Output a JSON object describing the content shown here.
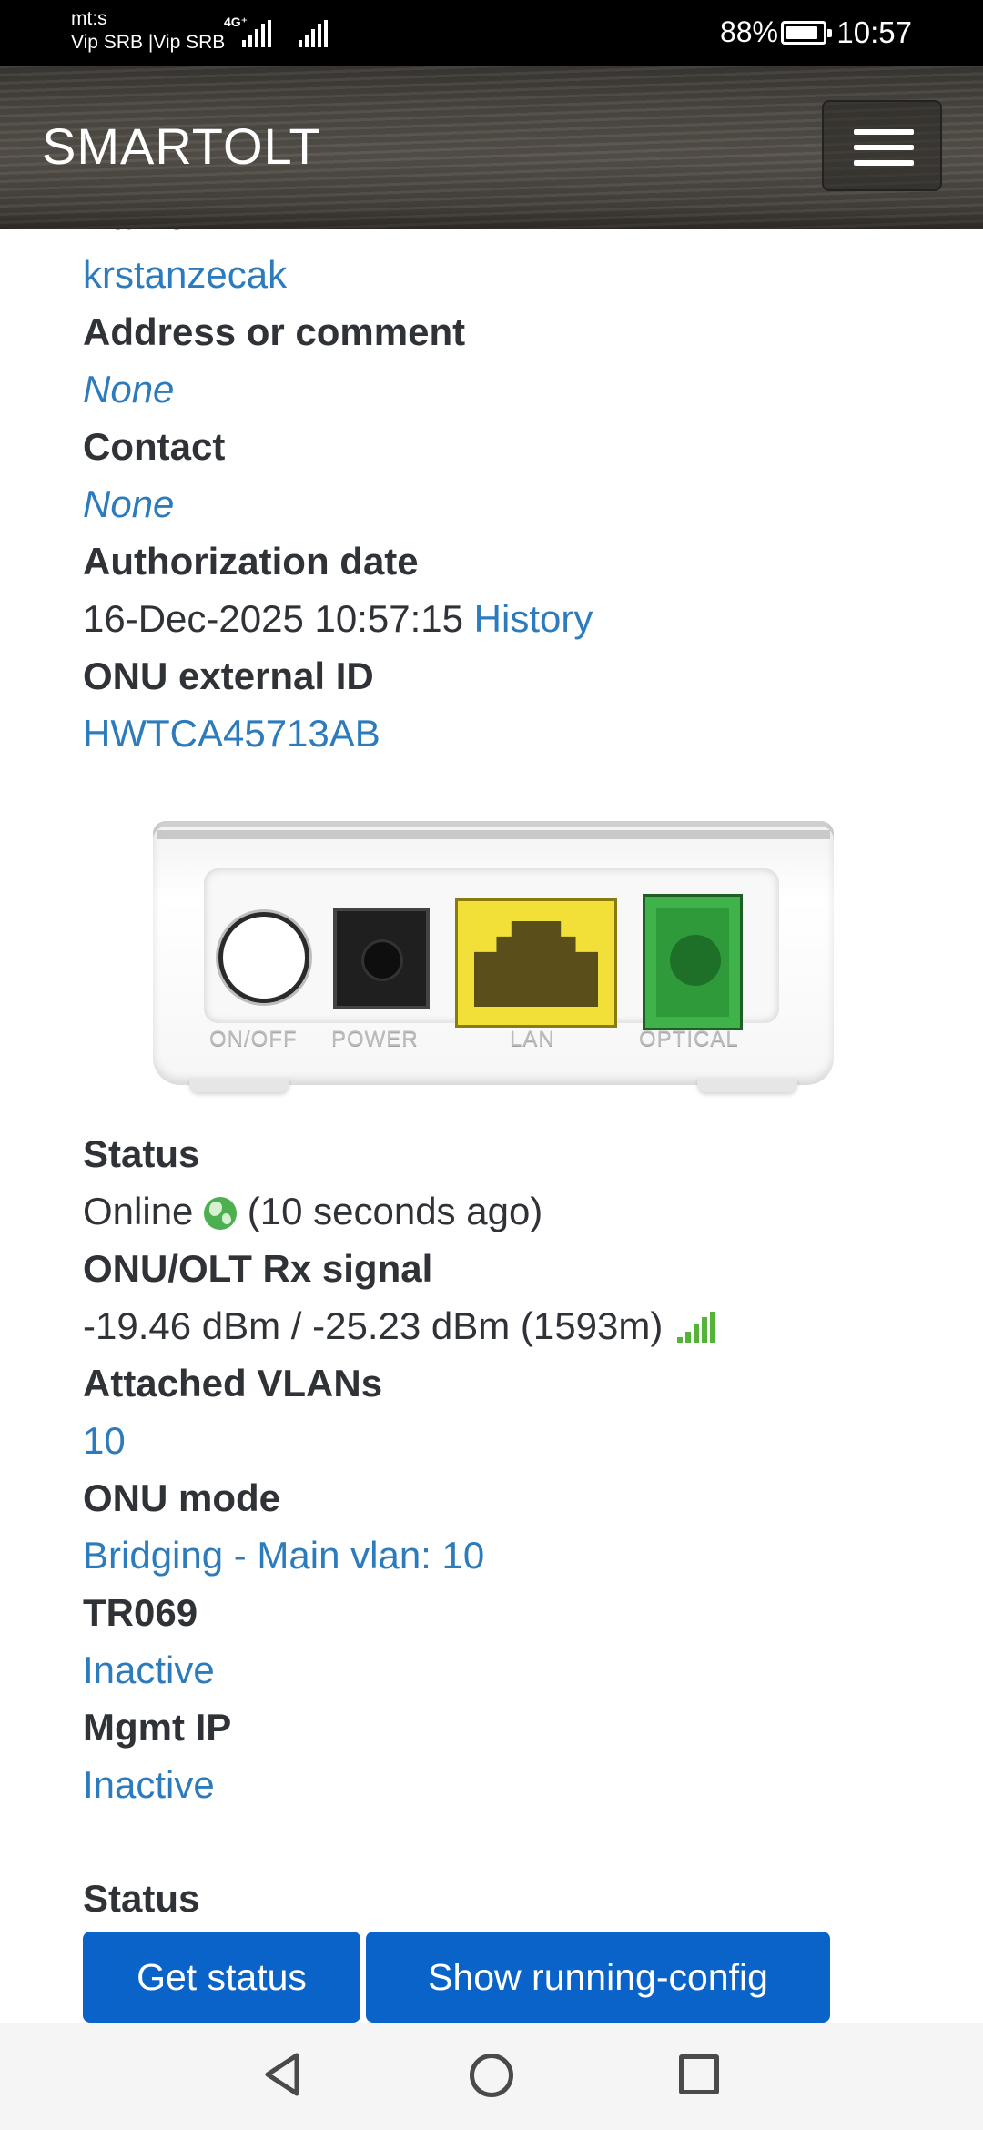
{
  "status_bar": {
    "carrier_line1": "mt:s",
    "carrier_line2": "Vip SRB |Vip SRB",
    "network_type": "4G⁺",
    "battery": "88%",
    "time": "10:57"
  },
  "header": {
    "logo": "SMARTOLT",
    "menu_icon": "hamburger-menu-icon"
  },
  "onu_info": {
    "name_label": "Name",
    "name_value": "krstanzecak",
    "address_label": "Address or comment",
    "address_value": "None",
    "contact_label": "Contact",
    "contact_value": "None",
    "auth_date_label": "Authorization date",
    "auth_date_value": "16-Dec-2025 10:57:15",
    "history_link": "History",
    "external_id_label": "ONU external ID",
    "external_id_value": "HWTCA45713AB"
  },
  "device_image": {
    "port_labels": [
      "ON/OFF",
      "POWER",
      "LAN",
      "OPTICAL"
    ],
    "lan_color": "#f2e038",
    "optical_color": "#3fb24a"
  },
  "onu_status": {
    "status_label": "Status",
    "status_value": "Online",
    "status_icon": "globe-icon",
    "status_age": "(10 seconds ago)",
    "rx_label": "ONU/OLT Rx signal",
    "rx_value": "-19.46 dBm / -25.23 dBm (1593m)",
    "rx_icon": "signal-bars-icon",
    "vlans_label": "Attached VLANs",
    "vlans_value": "10",
    "mode_label": "ONU mode",
    "mode_value": "Bridging - Main vlan: 10",
    "tr069_label": "TR069",
    "tr069_value": "Inactive",
    "mgmt_label": "Mgmt IP",
    "mgmt_value": "Inactive"
  },
  "actions": {
    "section_label": "Status",
    "get_status": "Get status",
    "show_config": "Show running-config"
  },
  "colors": {
    "link": "#2b7bbd",
    "text": "#2f3237",
    "button": "#0a63c9",
    "online_green": "#4caf50"
  }
}
